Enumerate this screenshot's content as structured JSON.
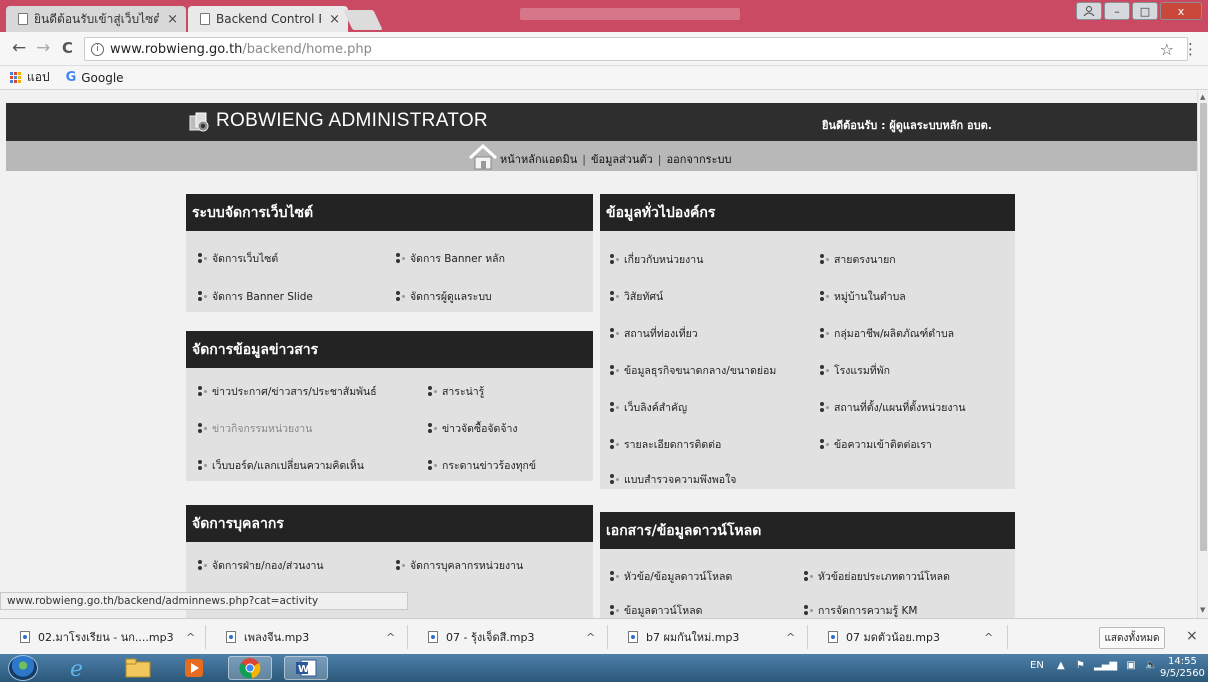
{
  "browser": {
    "tabs": [
      {
        "label": "ยินดีต้อนรับเข้าสู่เว็บไซต์องค์",
        "active": false
      },
      {
        "label": "Backend Control Panel",
        "active": true
      }
    ],
    "close_glyph": "×",
    "window_buttons": {
      "minimize": "–",
      "maximize": "□",
      "close": "x"
    },
    "nav": {
      "back": "←",
      "forward": "→",
      "reload": "C"
    },
    "url_host": "www.robwieng.go.th",
    "url_path": "/backend/home.php",
    "bookmarks": {
      "apps_label": "แอป",
      "google_label": "Google"
    },
    "status_url": "www.robwieng.go.th/backend/adminnews.php?cat=activity"
  },
  "site": {
    "title": "ROBWIENG ADMINISTRATOR",
    "welcome": "ยินดีต้อนรับ :  ผู้ดูแลระบบหลัก อบต.",
    "nav": [
      "หน้าหลักแอดมิน",
      "ข้อมูลส่วนตัว",
      "ออกจากระบบ"
    ],
    "nav_sep": "|"
  },
  "panels": {
    "website": {
      "title": "ระบบจัดการเว็บไซต์",
      "items": [
        "จัดการเว็บไซต์",
        "จัดการ Banner หลัก",
        "จัดการ Banner Slide",
        "จัดการผู้ดูแลระบบ"
      ]
    },
    "news": {
      "title": "จัดการข้อมูลข่าวสาร",
      "items": [
        "ข่าวประกาศ/ข่าวสาร/ประชาสัมพันธ์",
        "สาระน่ารู้",
        "ข่าวกิจกรรมหน่วยงาน",
        "ข่าวจัดซื้อจัดจ้าง",
        "เว็บบอร์ด/แลกเปลี่ยนความคิดเห็น",
        "กระดานข่าวร้องทุกข์"
      ]
    },
    "personnel": {
      "title": "จัดการบุคลากร",
      "items": [
        "จัดการฝ่าย/กอง/ส่วนงาน",
        "จัดการบุคลากรหน่วยงาน"
      ]
    },
    "org": {
      "title": "ข้อมูลทั่วไปองค์กร",
      "items": [
        "เกี่ยวกับหน่วยงาน",
        "สายตรงนายก",
        "วิสัยทัศน์",
        "หมู่บ้านในตำบล",
        "สถานที่ท่องเที่ยว",
        "กลุ่มอาชีพ/ผลิตภัณฑ์ตำบล",
        "ข้อมูลธุรกิจขนาดกลาง/ขนาดย่อม",
        "โรงแรมที่พัก",
        "เว็บลิงค์สำคัญ",
        "สถานที่ตั้ง/แผนที่ตั้งหน่วยงาน",
        "รายละเอียดการติดต่อ",
        "ข้อความเข้าติดต่อเรา",
        "แบบสำรวจความพึงพอใจ"
      ]
    },
    "docs": {
      "title": "เอกสาร/ข้อมูลดาวน์โหลด",
      "items": [
        "หัวข้อ/ข้อมูลดาวน์โหลด",
        "หัวข้อย่อยประเภทดาวน์โหลด",
        "ข้อมูลดาวน์โหลด",
        "การจัดการความรู้ KM"
      ]
    }
  },
  "downloads": {
    "files": [
      "02.มาโรงเรียน - นก....mp3",
      "เพลงจีน.mp3",
      "07 - รุ้งเจ็ดสี.mp3",
      "b7 ผมกันใหม่.mp3",
      "07 มดตัวน้อย.mp3"
    ],
    "chevron": "^",
    "show_all": "แสดงทั้งหมด",
    "close": "×"
  },
  "taskbar": {
    "lang": "EN",
    "time": "14:55",
    "date": "9/5/2560"
  },
  "colors": {
    "header": "#2e2e2e",
    "subnav": "#b8b8b8",
    "panel": "#e1e1e1",
    "panel_head": "#232323",
    "tabstrip": "#c94a62"
  }
}
